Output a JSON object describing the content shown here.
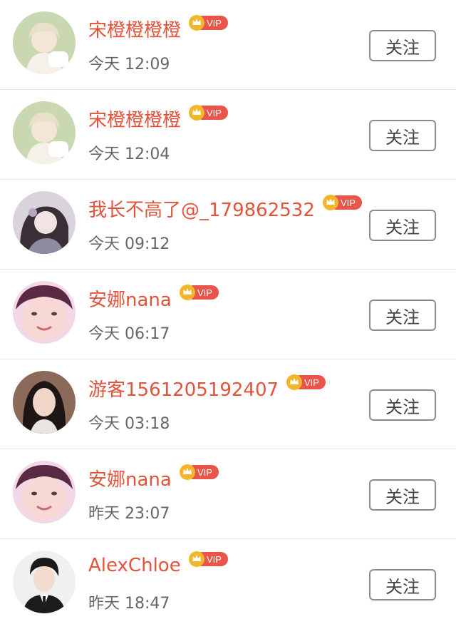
{
  "colors": {
    "name": "#e2533b",
    "time": "#666666",
    "vip_badge": "#e9554a",
    "crown": "#f3b52a"
  },
  "follow_label": "关注",
  "vip_label": "VIP",
  "users": [
    {
      "name": "宋橙橙橙橙",
      "time": "今天 12:09",
      "avatar": "anime-boy"
    },
    {
      "name": "宋橙橙橙橙",
      "time": "今天 12:04",
      "avatar": "anime-boy"
    },
    {
      "name": "我长不高了@_179862532",
      "time": "今天 09:12",
      "avatar": "anime-girl"
    },
    {
      "name": "安娜nana",
      "time": "今天 06:17",
      "avatar": "girl-photo"
    },
    {
      "name": "游客1561205192407",
      "time": "今天 03:18",
      "avatar": "woman-photo"
    },
    {
      "name": "安娜nana",
      "time": "昨天 23:07",
      "avatar": "girl-photo"
    },
    {
      "name": "AlexChloe",
      "time": "昨天 18:47",
      "avatar": "man-suit"
    }
  ]
}
